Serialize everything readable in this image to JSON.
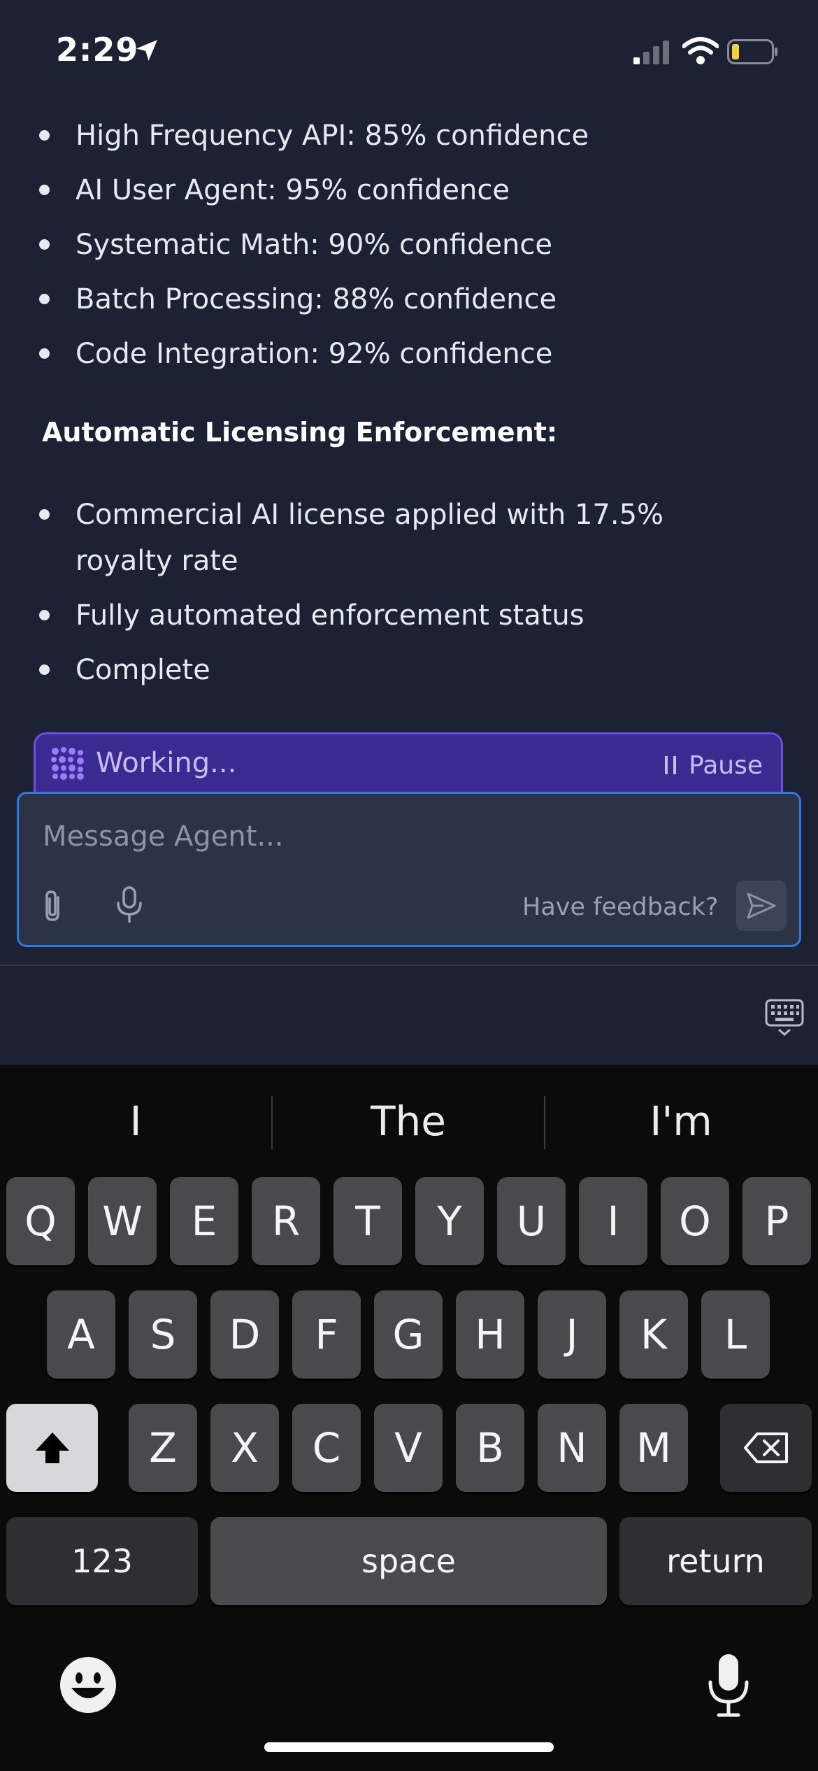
{
  "status_bar": {
    "time": "2:29"
  },
  "content": {
    "confidence_items": [
      "High Frequency API: 85% confidence",
      "AI User Agent: 95% confidence",
      "Systematic Math: 90% confidence",
      "Batch Processing: 88% confidence",
      "Code Integration: 92% confidence"
    ],
    "licensing_heading": "Automatic Licensing Enforcement:",
    "licensing_items": [
      "Commercial AI license applied with 17.5% royalty rate",
      "Fully automated enforcement status",
      "Complete"
    ]
  },
  "working": {
    "label": "Working...",
    "pause_label": "Pause"
  },
  "composer": {
    "placeholder": "Message Agent...",
    "feedback_label": "Have feedback?"
  },
  "keyboard": {
    "suggestions": [
      "I",
      "The",
      "I'm"
    ],
    "row1": [
      "Q",
      "W",
      "E",
      "R",
      "T",
      "Y",
      "U",
      "I",
      "O",
      "P"
    ],
    "row2": [
      "A",
      "S",
      "D",
      "F",
      "G",
      "H",
      "J",
      "K",
      "L"
    ],
    "row3": [
      "Z",
      "X",
      "C",
      "V",
      "B",
      "N",
      "M"
    ],
    "numbers_label": "123",
    "space_label": "space",
    "return_label": "return"
  },
  "colors": {
    "accent": "#2f7bd9",
    "working_bg": "#3b2a8f",
    "working_text": "#c9bbff"
  }
}
